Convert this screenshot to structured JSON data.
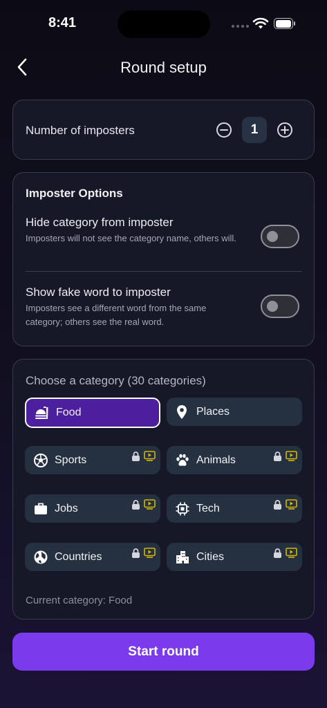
{
  "status_bar": {
    "time": "8:41"
  },
  "header": {
    "title": "Round setup"
  },
  "imposters": {
    "label": "Number of imposters",
    "value": "1"
  },
  "options": {
    "heading": "Imposter Options",
    "items": [
      {
        "title": "Hide category from imposter",
        "description": "Imposters will not see the category name, others will.",
        "enabled": false
      },
      {
        "title": "Show fake word to imposter",
        "description": "Imposters see a different word from the same category; others see the real word.",
        "enabled": false
      }
    ]
  },
  "categories": {
    "heading": "Choose a category (30 categories)",
    "items": [
      {
        "label": "Food",
        "icon": "food-icon",
        "selected": true,
        "locked": false
      },
      {
        "label": "Places",
        "icon": "location-pin-icon",
        "selected": false,
        "locked": false
      },
      {
        "label": "Sports",
        "icon": "soccer-ball-icon",
        "selected": false,
        "locked": true
      },
      {
        "label": "Animals",
        "icon": "paw-icon",
        "selected": false,
        "locked": true
      },
      {
        "label": "Jobs",
        "icon": "briefcase-icon",
        "selected": false,
        "locked": true
      },
      {
        "label": "Tech",
        "icon": "chip-icon",
        "selected": false,
        "locked": true
      },
      {
        "label": "Countries",
        "icon": "globe-icon",
        "selected": false,
        "locked": true
      },
      {
        "label": "Cities",
        "icon": "buildings-icon",
        "selected": false,
        "locked": true
      }
    ],
    "current": "Current category: Food"
  },
  "actions": {
    "start_label": "Start round"
  },
  "colors": {
    "accent": "#7c3aed",
    "selected_chip": "#4c1f9e",
    "chip": "#253040",
    "card": "#171827",
    "lock_badge": "#d4b800"
  }
}
